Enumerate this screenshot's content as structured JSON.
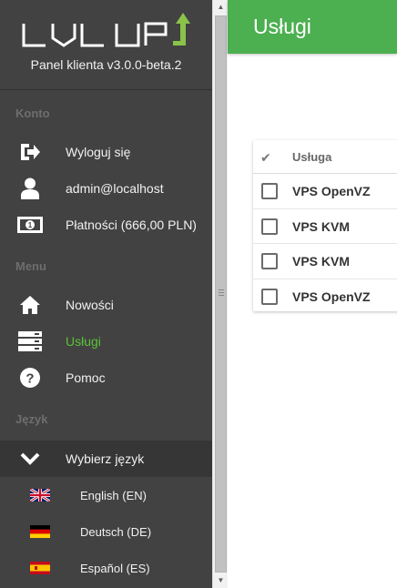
{
  "brand": {
    "logo_text": "LVL UP",
    "panel_version": "Panel klienta v3.0.0-beta.2"
  },
  "sidebar": {
    "sections": {
      "account": "Konto",
      "menu": "Menu",
      "language": "Język"
    },
    "account_items": [
      {
        "label": "Wyloguj się",
        "icon": "sign-out-icon"
      },
      {
        "label": "admin@localhost",
        "icon": "user-icon"
      },
      {
        "label": "Płatności (666,00 PLN)",
        "icon": "money-icon"
      }
    ],
    "menu_items": [
      {
        "label": "Nowości",
        "icon": "home-icon",
        "active": false
      },
      {
        "label": "Usługi",
        "icon": "server-icon",
        "active": true
      },
      {
        "label": "Pomoc",
        "icon": "help-icon",
        "active": false
      }
    ],
    "language_toggle": {
      "label": "Wybierz język",
      "icon": "chevron-down-icon"
    },
    "languages": [
      {
        "label": "English (EN)",
        "icon": "uk-flag-icon"
      },
      {
        "label": "Deutsch (DE)",
        "icon": "germany-flag-icon"
      },
      {
        "label": "Español (ES)",
        "icon": "spain-flag-icon"
      }
    ]
  },
  "header": {
    "title": "Usługi"
  },
  "services_table": {
    "columns": [
      "Usługa"
    ],
    "rows": [
      {
        "name": "VPS OpenVZ",
        "checked": false
      },
      {
        "name": "VPS KVM",
        "checked": false
      },
      {
        "name": "VPS KVM",
        "checked": false
      },
      {
        "name": "VPS OpenVZ",
        "checked": false
      }
    ]
  },
  "colors": {
    "accent": "#4caf50",
    "active_link": "#5bc236",
    "sidebar_bg": "#424242"
  }
}
